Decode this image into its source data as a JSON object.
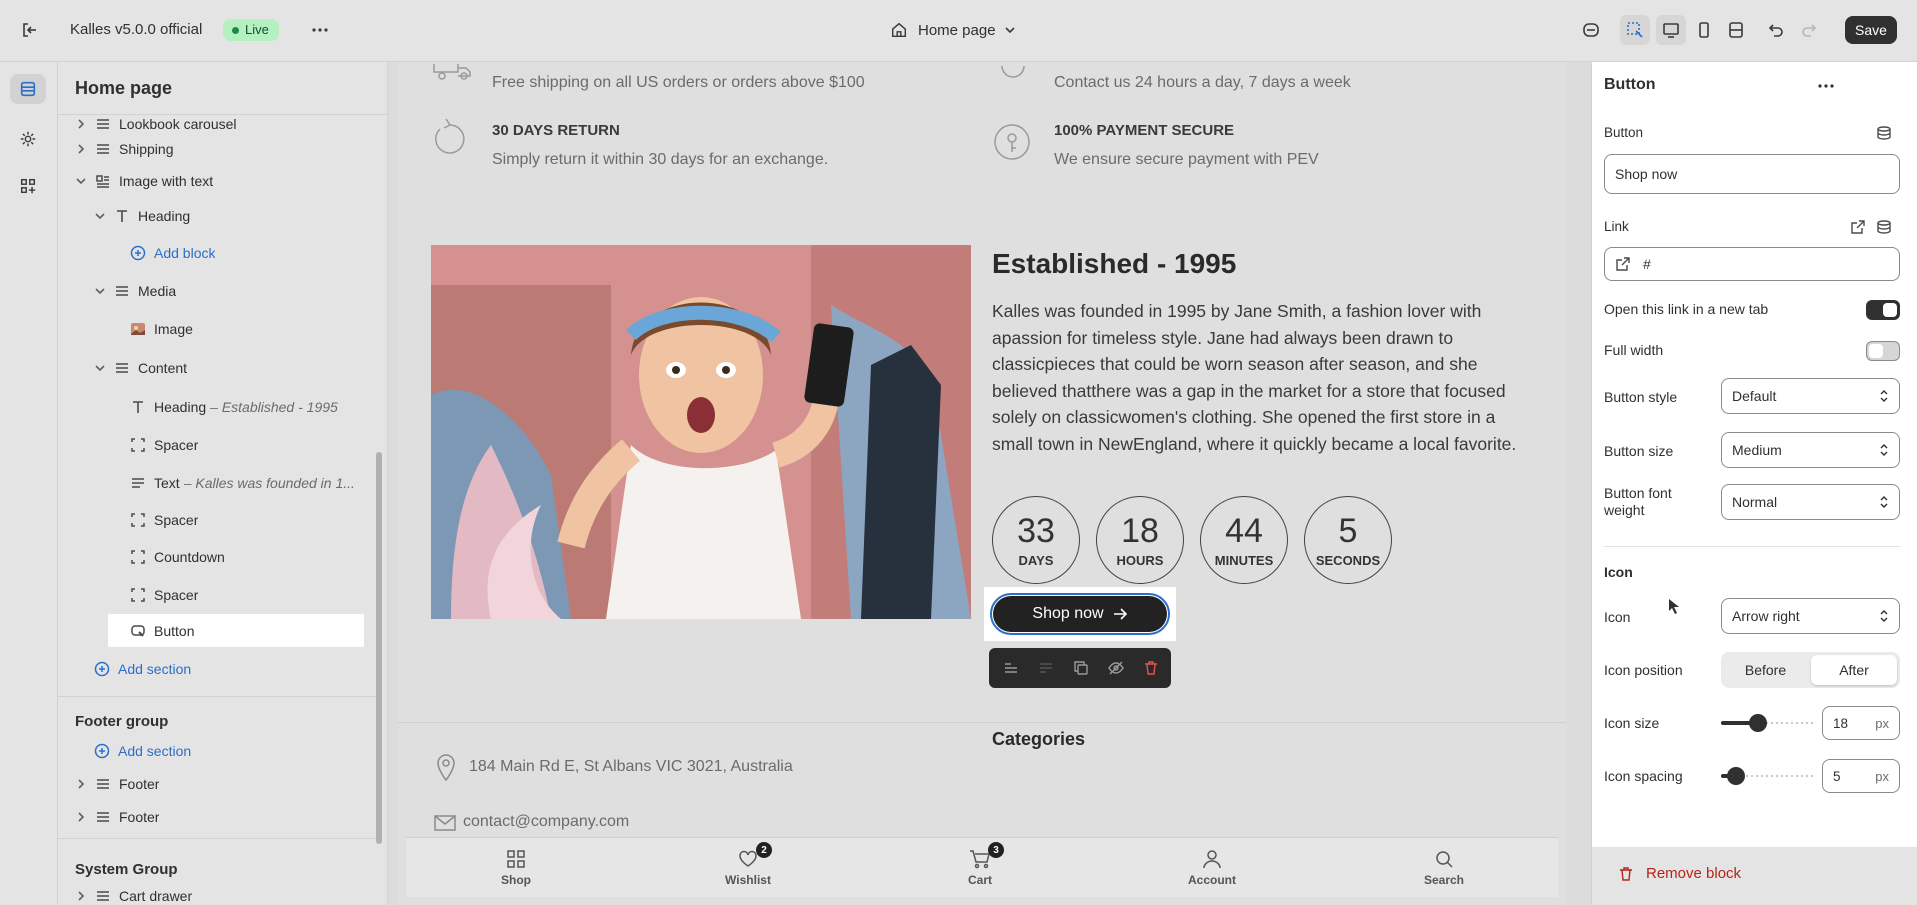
{
  "topbar": {
    "store_name": "Kalles v5.0.0 official",
    "live_badge": "Live",
    "page_selector": "Home page",
    "save_label": "Save"
  },
  "left_panel": {
    "title": "Home page",
    "tree": [
      {
        "label": "Lookbook carousel",
        "icon": "section-icon",
        "chevron": "right"
      },
      {
        "label": "Shipping",
        "icon": "section-icon",
        "chevron": "right"
      },
      {
        "label": "Image with text",
        "icon": "section-icon",
        "chevron": "down"
      },
      {
        "label": "Heading",
        "icon": "text-icon",
        "chevron": "down"
      },
      {
        "label": "Add block",
        "icon": "plus-circle-icon",
        "chevron": ""
      },
      {
        "label": "Media",
        "icon": "section-icon",
        "chevron": "down"
      },
      {
        "label": "Image",
        "icon": "image-icon",
        "chevron": ""
      },
      {
        "label": "Content",
        "icon": "section-icon",
        "chevron": "down"
      },
      {
        "label": "Heading",
        "sub": "– Established - 1995",
        "icon": "text-icon",
        "chevron": ""
      },
      {
        "label": "Spacer",
        "icon": "spacer-icon",
        "chevron": ""
      },
      {
        "label": "Text",
        "sub": "– Kalles was founded in 1...",
        "icon": "lines-icon",
        "chevron": ""
      },
      {
        "label": "Spacer",
        "icon": "spacer-icon",
        "chevron": ""
      },
      {
        "label": "Countdown",
        "icon": "spacer-icon",
        "chevron": ""
      },
      {
        "label": "Spacer",
        "icon": "spacer-icon",
        "chevron": ""
      },
      {
        "label": "Button",
        "icon": "button-icon",
        "chevron": ""
      }
    ],
    "add_section": "Add section",
    "footer_group": {
      "title": "Footer group",
      "add_section": "Add section",
      "items": [
        "Footer",
        "Footer"
      ]
    },
    "system_group": {
      "title": "System Group",
      "items": [
        "Cart drawer"
      ]
    }
  },
  "preview": {
    "features": [
      {
        "title": "",
        "desc": "Free shipping on all US orders or orders above $100"
      },
      {
        "title": "",
        "desc": "Contact us 24 hours a day, 7 days a week"
      },
      {
        "title": "30 DAYS RETURN",
        "desc": "Simply return it within 30 days for an exchange."
      },
      {
        "title": "100% PAYMENT SECURE",
        "desc": "We ensure secure payment with PEV"
      }
    ],
    "heading": "Established - 1995",
    "body": "Kalles was founded in 1995 by Jane Smith, a fashion lover with apassion for timeless style. Jane had always been drawn to classicpieces that could be worn season after season, and she believed thatthere was a gap in the market for a store that focused solely on classicwomen's clothing. She opened the first store in a small town in NewEngland, where it quickly became a local favorite.",
    "countdown": [
      {
        "value": "33",
        "unit": "DAYS"
      },
      {
        "value": "18",
        "unit": "HOURS"
      },
      {
        "value": "44",
        "unit": "MINUTES"
      },
      {
        "value": "5",
        "unit": "SECONDS"
      }
    ],
    "button_label": "Shop now",
    "categories_title": "Categories",
    "address": "184 Main Rd E, St Albans VIC 3021, Australia",
    "email": "contact@company.com",
    "bottom_nav": [
      {
        "label": "Shop",
        "icon": "grid-icon",
        "badge": ""
      },
      {
        "label": "Wishlist",
        "icon": "heart-icon",
        "badge": "2"
      },
      {
        "label": "Cart",
        "icon": "cart-icon",
        "badge": "3"
      },
      {
        "label": "Account",
        "icon": "user-icon",
        "badge": ""
      },
      {
        "label": "Search",
        "icon": "search-icon",
        "badge": ""
      }
    ]
  },
  "right_panel": {
    "title": "Button",
    "button_label": "Button",
    "button_value": "Shop now",
    "link_label": "Link",
    "link_value": "#",
    "new_tab_label": "Open this link in a new tab",
    "new_tab_on": true,
    "full_width_label": "Full width",
    "full_width_on": false,
    "button_style_label": "Button style",
    "button_style_value": "Default",
    "button_size_label": "Button size",
    "button_size_value": "Medium",
    "font_weight_label": "Button font weight",
    "font_weight_value": "Normal",
    "icon_section": "Icon",
    "icon_label": "Icon",
    "icon_value": "Arrow right",
    "icon_position_label": "Icon position",
    "icon_position_options": [
      "Before",
      "After"
    ],
    "icon_position_selected": "After",
    "icon_size_label": "Icon size",
    "icon_size_value": "18",
    "icon_spacing_label": "Icon spacing",
    "icon_spacing_value": "5",
    "unit": "px",
    "remove_block": "Remove block"
  },
  "colors": {
    "accent_blue": "#2c6ecb",
    "live_green": "#b4f0c0",
    "danger": "#b42318",
    "dark": "#303030"
  }
}
